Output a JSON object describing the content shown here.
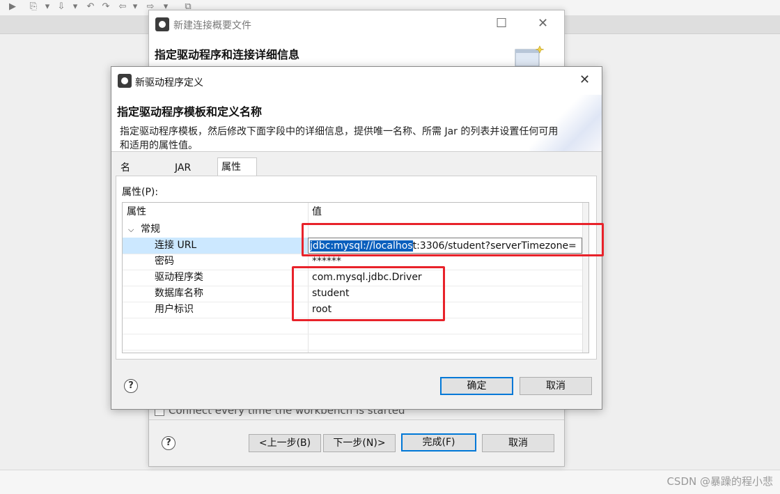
{
  "background_dialog": {
    "title": "新建连接概要文件",
    "heading": "指定驱动程序和连接详细信息",
    "checkbox_label": "Connect every time the workbench is started",
    "buttons": {
      "back": "<上一步(B)",
      "next": "下一步(N)>",
      "finish": "完成(F)",
      "cancel": "取消"
    }
  },
  "front_dialog": {
    "title": "新驱动程序定义",
    "heading": "指定驱动程序模板和定义名称",
    "description": "指定驱动程序模板，然后修改下面字段中的详细信息，提供唯一名称、所需 Jar 的列表并设置任何可用和适用的属性值。",
    "tabs": [
      "名称/类型",
      "JAR List",
      "属性"
    ],
    "active_tab": "属性",
    "properties_label": "属性(P):",
    "table": {
      "headers": [
        "属性",
        "值"
      ],
      "group": "常规",
      "url_row": {
        "key": "连接 URL",
        "selected": "jdbc:mysql://localhos",
        "rest": "t:3306/student?serverTimezone="
      },
      "rows": [
        {
          "key": "密码",
          "value": "******"
        },
        {
          "key": "驱动程序类",
          "value": "com.mysql.jdbc.Driver"
        },
        {
          "key": "数据库名称",
          "value": "student"
        },
        {
          "key": "用户标识",
          "value": "root"
        }
      ]
    },
    "buttons": {
      "ok": "确定",
      "cancel": "取消"
    }
  },
  "help_glyph": "?",
  "watermark": "CSDN @暴躁的程小悲",
  "colors": {
    "annotation_red": "#e8222a",
    "selection_blue": "#0a5fbd",
    "row_highlight": "#cce8ff",
    "default_button_border": "#0078d7"
  }
}
